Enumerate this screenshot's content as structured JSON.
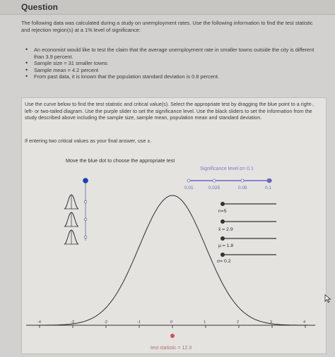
{
  "header": {
    "title": "Question"
  },
  "intro": "The following data was calculated during a study on unemployment rates. Use the following information to find the test statistic and rejection region(s) at a 1% level of significance:",
  "bullets": [
    "An economist would like to test the claim that the average unemployment rate in smaller towns outside the city is different than 3.9 percent.",
    "Sample size = 31 smaller towns",
    "Sample mean = 4.2 percent",
    "From past data, it is known that the population standard deviation is 0.8 percent."
  ],
  "instructions": "Use the curve below to find the test statistic and critical value(s). Select the appropriate test by dragging the blue point to a right-, left- or two-tailed diagram. Use the purple slider to set the significance level. Use the black sliders to set the information from the study described above including the sample size, sample mean, population mean and standard deviation.",
  "hint": "If entering two critical values as your final answer, use ±.",
  "choose_label": "Move the blue dot to choose the appropriate test",
  "significance": {
    "label": "Significance level α= 0.1",
    "options": [
      "0.01",
      "0.025",
      "0.05",
      "0.1"
    ],
    "selected": "0.1",
    "color": "#6a67c0"
  },
  "sliders": {
    "n_label": "n=5",
    "mean_label": "x̄ = 2.9",
    "mu_label": "μ = 1.8",
    "sigma_label": "σ= 0.2"
  },
  "axis_ticks": [
    "-4",
    "-3",
    "-2",
    "-1",
    "0",
    "1",
    "2",
    "3",
    "4"
  ],
  "test_statistic_label": "test statistic = 12.3",
  "colors": {
    "blue_dot": "#1e3fb0",
    "curve": "#2e2e2e",
    "test_stat": "#cc5555"
  },
  "icons": {
    "tail_diagrams": "bell-curve-icon",
    "cursor": "mouse-pointer-icon"
  }
}
